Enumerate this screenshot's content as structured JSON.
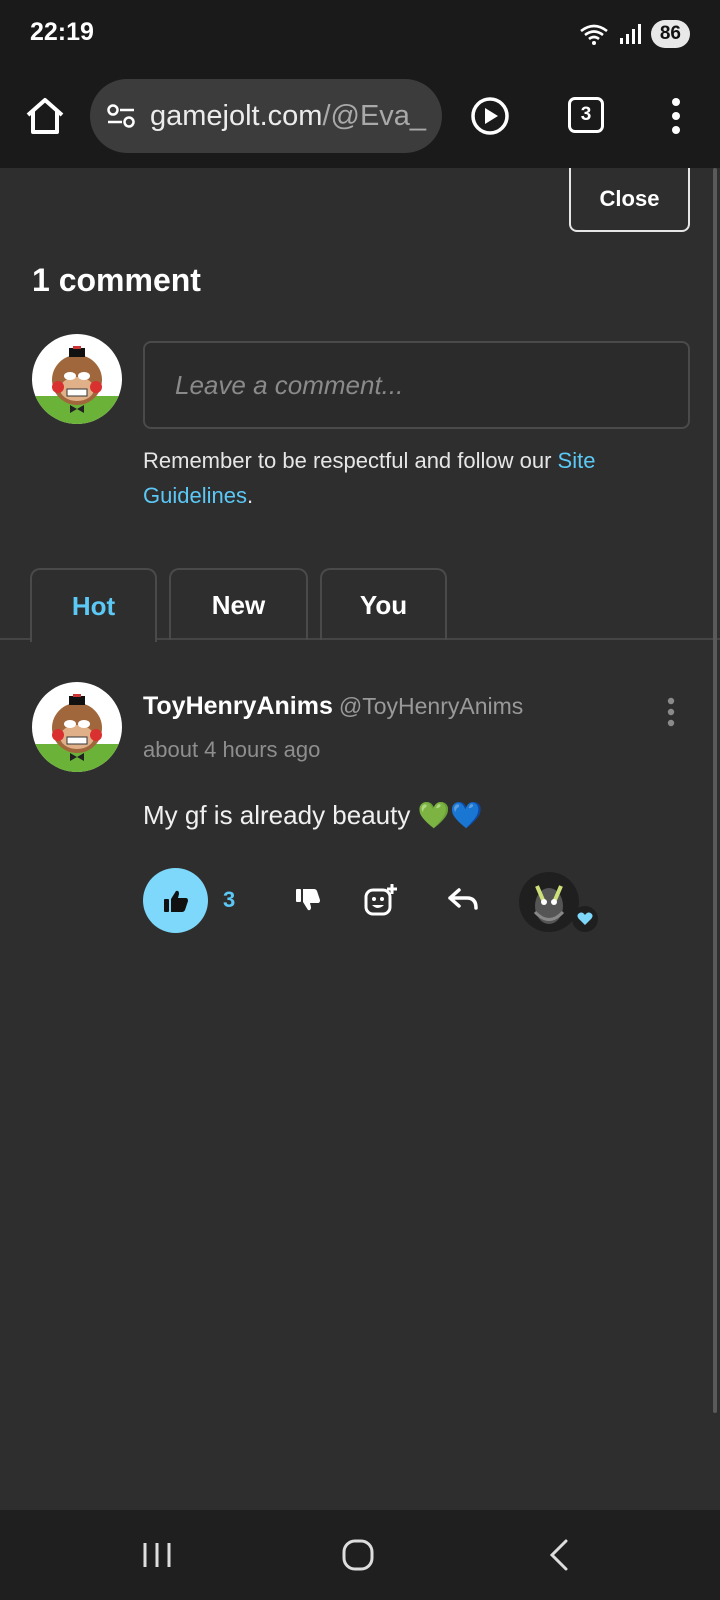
{
  "status_bar": {
    "time": "22:19",
    "battery": "86"
  },
  "browser": {
    "url_host": "gamejolt.com",
    "url_path": "/@Eva_",
    "tab_count": "3"
  },
  "comments_panel": {
    "close_label": "Close",
    "count_label": "1 comment",
    "input_placeholder": "Leave a comment...",
    "guidelines_prefix": "Remember to be respectful and follow our ",
    "guidelines_link": "Site Guidelines",
    "guidelines_suffix": ".",
    "tabs": [
      {
        "label": "Hot",
        "active": true
      },
      {
        "label": "New",
        "active": false
      },
      {
        "label": "You",
        "active": false
      }
    ]
  },
  "comments": [
    {
      "display_name": "ToyHenryAnims",
      "username": "@ToyHenryAnims",
      "time": "about 4 hours ago",
      "body": "My gf is already beauty 💚💙",
      "like_count": "3",
      "reaction_icon": "heart-icon"
    }
  ],
  "colors": {
    "accent": "#5bc8f5",
    "background": "#2e2e2e",
    "chrome": "#1a1a1a"
  }
}
